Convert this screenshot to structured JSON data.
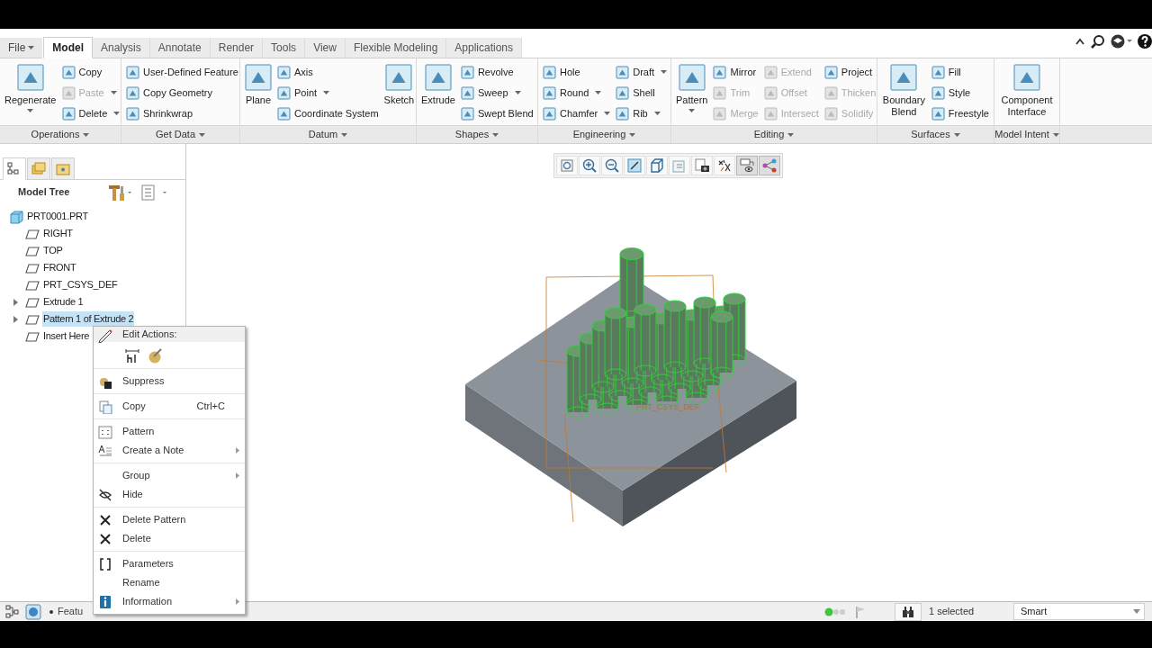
{
  "tabs": [
    {
      "label": "File",
      "kind": "menu",
      "selected": false
    },
    {
      "label": "Model",
      "kind": "tab",
      "selected": true
    },
    {
      "label": "Analysis",
      "kind": "tab",
      "selected": false
    },
    {
      "label": "Annotate",
      "kind": "tab",
      "selected": false
    },
    {
      "label": "Render",
      "kind": "tab",
      "selected": false
    },
    {
      "label": "Tools",
      "kind": "tab",
      "selected": false
    },
    {
      "label": "View",
      "kind": "tab",
      "selected": false
    },
    {
      "label": "Flexible Modeling",
      "kind": "tab",
      "selected": false
    },
    {
      "label": "Applications",
      "kind": "tab",
      "selected": false
    }
  ],
  "ribbon": [
    {
      "label": "Operations",
      "columns": [
        [
          {
            "label": "Regenerate",
            "kind": "large",
            "dropdown": true,
            "disabled": false
          }
        ],
        [
          {
            "label": "Copy",
            "kind": "small",
            "dropdown": false,
            "disabled": false
          },
          {
            "label": "Paste",
            "kind": "small",
            "dropdown": true,
            "disabled": true
          },
          {
            "label": "Delete",
            "kind": "small",
            "dropdown": true,
            "disabled": false
          }
        ]
      ]
    },
    {
      "label": "Get Data",
      "columns": [
        [
          {
            "label": "User-Defined Feature",
            "kind": "small",
            "dropdown": false,
            "disabled": false
          },
          {
            "label": "Copy Geometry",
            "kind": "small",
            "dropdown": false,
            "disabled": false
          },
          {
            "label": "Shrinkwrap",
            "kind": "small",
            "dropdown": false,
            "disabled": false
          }
        ]
      ]
    },
    {
      "label": "Datum",
      "columns": [
        [
          {
            "label": "Plane",
            "kind": "large",
            "dropdown": false,
            "disabled": false
          }
        ],
        [
          {
            "label": "Axis",
            "kind": "small",
            "dropdown": false,
            "disabled": false
          },
          {
            "label": "Point",
            "kind": "small",
            "dropdown": true,
            "disabled": false
          },
          {
            "label": "Coordinate System",
            "kind": "small",
            "dropdown": false,
            "disabled": false
          }
        ],
        [
          {
            "label": "Sketch",
            "kind": "large",
            "dropdown": false,
            "disabled": false
          }
        ]
      ]
    },
    {
      "label": "Shapes",
      "columns": [
        [
          {
            "label": "Extrude",
            "kind": "large",
            "dropdown": false,
            "disabled": false
          }
        ],
        [
          {
            "label": "Revolve",
            "kind": "small",
            "dropdown": false,
            "disabled": false
          },
          {
            "label": "Sweep",
            "kind": "small",
            "dropdown": true,
            "disabled": false
          },
          {
            "label": "Swept Blend",
            "kind": "small",
            "dropdown": false,
            "disabled": false
          }
        ]
      ]
    },
    {
      "label": "Engineering",
      "columns": [
        [
          {
            "label": "Hole",
            "kind": "small",
            "dropdown": false,
            "disabled": false
          },
          {
            "label": "Round",
            "kind": "small",
            "dropdown": true,
            "disabled": false
          },
          {
            "label": "Chamfer",
            "kind": "small",
            "dropdown": true,
            "disabled": false
          }
        ],
        [
          {
            "label": "Draft",
            "kind": "small",
            "dropdown": true,
            "disabled": false
          },
          {
            "label": "Shell",
            "kind": "small",
            "dropdown": false,
            "disabled": false
          },
          {
            "label": "Rib",
            "kind": "small",
            "dropdown": true,
            "disabled": false
          }
        ]
      ]
    },
    {
      "label": "Editing",
      "columns": [
        [
          {
            "label": "Pattern",
            "kind": "large",
            "dropdown": true,
            "disabled": false
          }
        ],
        [
          {
            "label": "Mirror",
            "kind": "small",
            "dropdown": false,
            "disabled": false
          },
          {
            "label": "Trim",
            "kind": "small",
            "dropdown": false,
            "disabled": true
          },
          {
            "label": "Merge",
            "kind": "small",
            "dropdown": false,
            "disabled": true
          }
        ],
        [
          {
            "label": "Extend",
            "kind": "small",
            "dropdown": false,
            "disabled": true
          },
          {
            "label": "Offset",
            "kind": "small",
            "dropdown": false,
            "disabled": true
          },
          {
            "label": "Intersect",
            "kind": "small",
            "dropdown": false,
            "disabled": true
          }
        ],
        [
          {
            "label": "Project",
            "kind": "small",
            "dropdown": false,
            "disabled": false
          },
          {
            "label": "Thicken",
            "kind": "small",
            "dropdown": false,
            "disabled": true
          },
          {
            "label": "Solidify",
            "kind": "small",
            "dropdown": false,
            "disabled": true
          }
        ]
      ]
    },
    {
      "label": "Surfaces",
      "columns": [
        [
          {
            "label": "Boundary Blend",
            "kind": "large",
            "dropdown": false,
            "disabled": false
          }
        ],
        [
          {
            "label": "Fill",
            "kind": "small",
            "dropdown": false,
            "disabled": false
          },
          {
            "label": "Style",
            "kind": "small",
            "dropdown": false,
            "disabled": false
          },
          {
            "label": "Freestyle",
            "kind": "small",
            "dropdown": false,
            "disabled": false
          }
        ]
      ]
    },
    {
      "label": "Model Intent",
      "columns": [
        [
          {
            "label": "Component Interface",
            "kind": "large",
            "dropdown": false,
            "disabled": false
          }
        ]
      ]
    }
  ],
  "view_toolbar": [
    {
      "selected": false
    },
    {
      "selected": false
    },
    {
      "selected": false
    },
    {
      "selected": false
    },
    {
      "selected": false
    },
    {
      "selected": false
    },
    {
      "selected": false
    },
    {
      "selected": false
    },
    {
      "selected": true
    },
    {
      "selected": true
    }
  ],
  "navigator_tabs": [
    {
      "selected": true
    },
    {
      "selected": false
    },
    {
      "selected": false
    }
  ],
  "model_tree": {
    "title": "Model Tree",
    "items": [
      {
        "label": "PRT0001.PRT",
        "selected": false,
        "children": [
          {
            "label": "RIGHT",
            "selected": false
          },
          {
            "label": "TOP",
            "selected": false
          },
          {
            "label": "FRONT",
            "selected": false
          },
          {
            "label": "PRT_CSYS_DEF",
            "selected": false
          },
          {
            "label": "Extrude 1",
            "selected": false,
            "expanded": false
          },
          {
            "label": "Pattern 1 of Extrude 2",
            "selected": true,
            "expanded": false
          },
          {
            "label": "Insert Here",
            "selected": false
          }
        ]
      }
    ]
  },
  "viewport": {
    "csys_label": "PRT_CSYS_DEF"
  },
  "context_menu": {
    "header": "Edit Actions:",
    "sections": [
      [
        {
          "label": "Suppress",
          "has_icon": true,
          "submenu": false
        }
      ],
      [
        {
          "label": "Copy",
          "shortcut": "Ctrl+C",
          "has_icon": true,
          "submenu": false
        }
      ],
      [
        {
          "label": "Pattern",
          "has_icon": true,
          "submenu": false
        },
        {
          "label": "Create a Note",
          "has_icon": true,
          "submenu": true
        }
      ],
      [
        {
          "label": "Group",
          "has_icon": false,
          "submenu": true
        },
        {
          "label": "Hide",
          "has_icon": true,
          "submenu": false
        }
      ],
      [
        {
          "label": "Delete Pattern",
          "has_icon": true,
          "submenu": false
        },
        {
          "label": "Delete",
          "has_icon": true,
          "submenu": false
        }
      ],
      [
        {
          "label": "Parameters",
          "has_icon": true,
          "submenu": false
        },
        {
          "label": "Rename",
          "has_icon": false,
          "submenu": false
        },
        {
          "label": "Information",
          "has_icon": true,
          "submenu": true
        }
      ]
    ]
  },
  "status_bar": {
    "message": "Featu",
    "selection": "1 selected",
    "filter": "Smart"
  }
}
